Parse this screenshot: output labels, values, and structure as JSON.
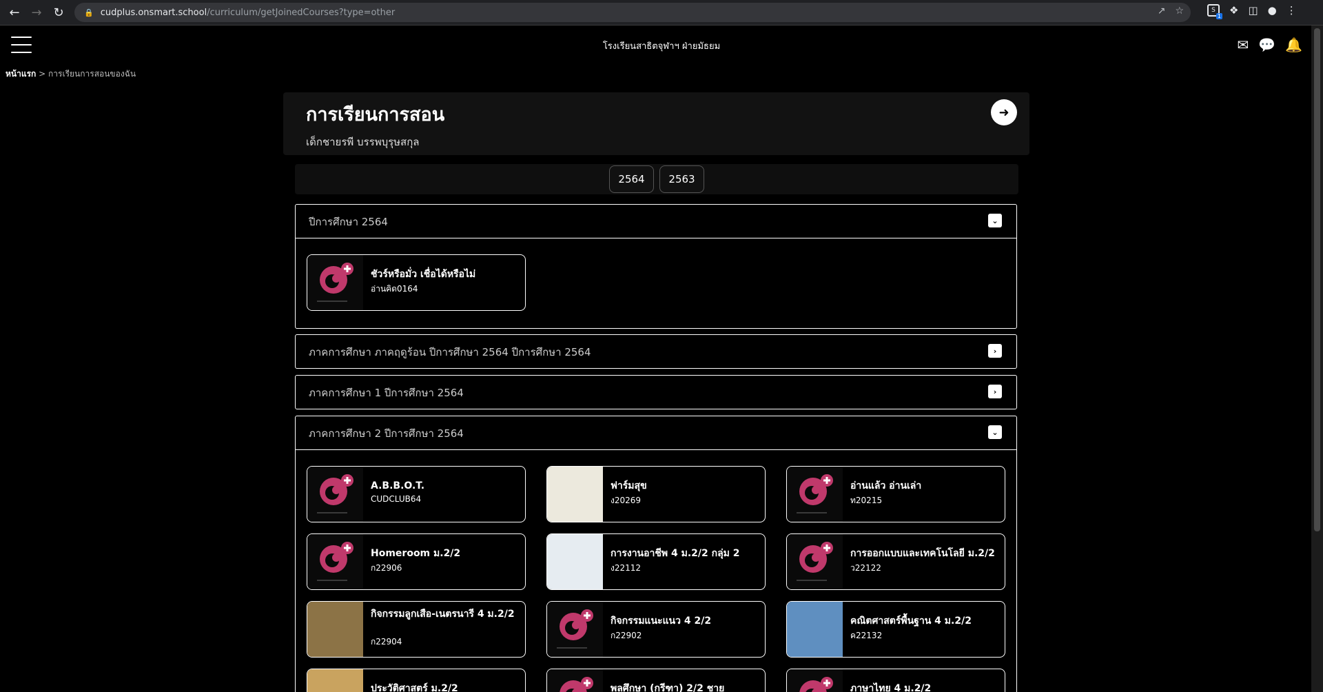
{
  "browser": {
    "url_host": "cudplus.onsmart.school",
    "url_path": "/curriculum/getJoinedCourses?type=other",
    "ext_badge_count": "1"
  },
  "header": {
    "school_name": "โรงเรียนสาธิตจุฬาฯ ฝ่ายมัธยม"
  },
  "breadcrumb": {
    "home": "หน้าแรก",
    "separator": ">",
    "current": "การเรียนการสอนของฉัน"
  },
  "title_card": {
    "title": "การเรียนการสอน",
    "student": "เด็กชายรพี บรรพบุรุษสกุล"
  },
  "year_tabs": [
    "2564",
    "2563"
  ],
  "panels": [
    {
      "title": "ปีการศึกษา 2564",
      "expanded": true,
      "courses": [
        {
          "name": "ชัวร์หรือมั่ว เชื่อได้หรือไม่",
          "code": "อ่านคิด0164",
          "thumb": "cudplus-logo"
        }
      ]
    },
    {
      "title": "ภาคการศึกษา ภาคฤดูร้อน ปีการศึกษา 2564 ปีการศึกษา 2564",
      "expanded": false
    },
    {
      "title": "ภาคการศึกษา 1 ปีการศึกษา 2564",
      "expanded": false
    },
    {
      "title": "ภาคการศึกษา 2 ปีการศึกษา 2564",
      "expanded": true,
      "courses": [
        {
          "name": "A.B.B.O.T.",
          "code": "CUDCLUB64",
          "thumb": "cudplus-logo"
        },
        {
          "name": "ฟาร์มสุข",
          "code": "ง20269",
          "thumb": "farm-of-happiness"
        },
        {
          "name": "อ่านแล้ว อ่านเล่า",
          "code": "ท20215",
          "thumb": "cudplus-logo"
        },
        {
          "name": "Homeroom ม.2/2",
          "code": "ก22906",
          "thumb": "cudplus-logo"
        },
        {
          "name": "การงานอาชีพ 4 ม.2/2 กลุ่ม 2",
          "code": "ง22112",
          "thumb": "career-illustration"
        },
        {
          "name": "การออกแบบและเทคโนโลยี ม.2/2",
          "code": "ว22122",
          "thumb": "cudplus-logo"
        },
        {
          "name": "กิจกรรมลูกเสือ-เนตรนารี 4 ม.2/2",
          "code": "ก22904",
          "thumb": "scout-emblem"
        },
        {
          "name": "กิจกรรมแนะแนว 4 2/2",
          "code": "ก22902",
          "thumb": "cudplus-logo"
        },
        {
          "name": "คณิตศาสตร์พื้นฐาน 4 ม.2/2",
          "code": "ค22132",
          "thumb": "math-shield"
        },
        {
          "name": "ประวัติศาสตร์ ม.2/2",
          "code": "",
          "thumb": "history-image"
        },
        {
          "name": "พลศึกษา (กรีฑา) 2/2 ชาย",
          "code": "",
          "thumb": "cudplus-logo"
        },
        {
          "name": "ภาษาไทย 4 ม.2/2",
          "code": "",
          "thumb": "cudplus-logo"
        }
      ]
    }
  ],
  "colors": {
    "background": "#000000",
    "card_border": "#ffffff",
    "brand_pink": "#c0396b"
  }
}
